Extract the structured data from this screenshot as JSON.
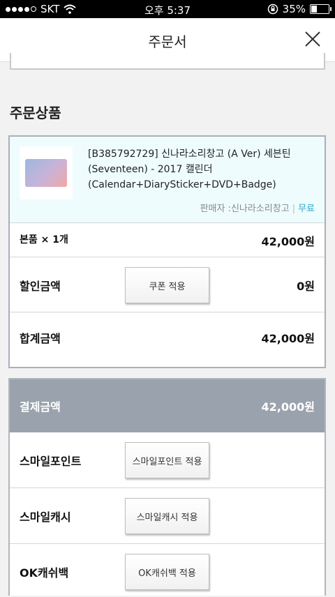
{
  "status_bar": {
    "carrier": "SKT",
    "time": "오후 5:37",
    "battery_text": "35%",
    "battery_level": 0.35,
    "signal_dots_filled": 4,
    "icons": [
      "wifi-icon",
      "orientation-lock-icon",
      "battery-icon"
    ]
  },
  "header": {
    "title": "주문서",
    "close_icon": "close-icon"
  },
  "section": {
    "title": "주문상품"
  },
  "product": {
    "name": "[B385792729] 신나라소리창고 (A Ver) 세븐틴 (Seventeen) - 2017 캘린더 (Calendar+DiarySticker+DVD+Badge)",
    "seller_label": "판매자 :신나라소리창고",
    "separator": "|",
    "shipping": "무료"
  },
  "order_rows": {
    "quantity_label": "본품 × 1개",
    "quantity_value": "42,000원",
    "discount_label": "할인금액",
    "coupon_button": "쿠폰 적용",
    "discount_value": "0원",
    "total_label": "합계금액",
    "total_value": "42,000원"
  },
  "payment": {
    "header_label": "결제금액",
    "header_value": "42,000원",
    "smile_point_label": "스마일포인트",
    "smile_point_button": "스마일포인트 적용",
    "smile_cash_label": "스마일캐시",
    "smile_cash_button": "스마일캐시 적용",
    "ok_cashbag_label": "OK캐쉬백",
    "ok_cashbag_button": "OK캐쉬백 적용"
  },
  "colors": {
    "product_bg": "#eefcfe",
    "payment_header_bg": "#9aa2ad",
    "free_shipping": "#2aa9c9"
  }
}
